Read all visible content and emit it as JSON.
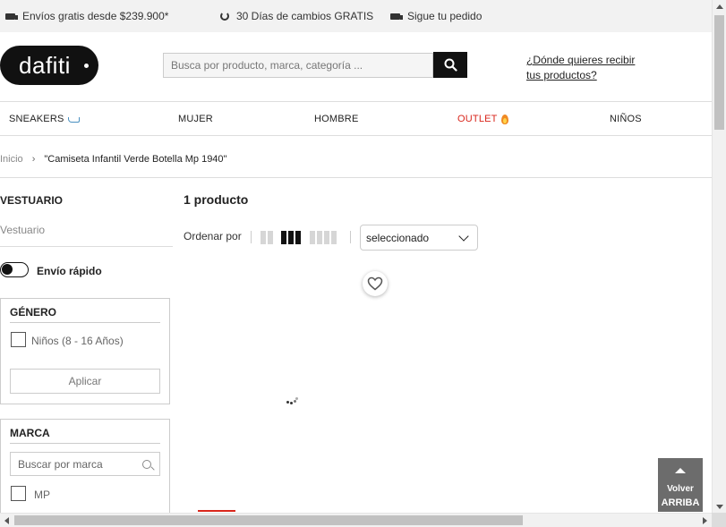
{
  "topbar": {
    "shipping": {
      "icon": "truck-icon",
      "text": "Envíos gratis desde $239.900*"
    },
    "returns": {
      "icon": "refresh-icon",
      "text": "30 Días de cambios GRATIS"
    },
    "tracking": {
      "icon": "truck-icon",
      "text": "Sigue tu pedido"
    }
  },
  "header": {
    "logo_text": "dafiti",
    "search_placeholder": "Busca por producto, marca, categoría ...",
    "search_value": "",
    "search_icon": "search-icon",
    "delivery_link": "¿Dónde quieres recibir tus productos?"
  },
  "nav": {
    "items": [
      {
        "label": "SNEAKERS",
        "icon": "sneaker-icon"
      },
      {
        "label": "MUJER"
      },
      {
        "label": "HOMBRE"
      },
      {
        "label": "OUTLET",
        "icon": "fire-icon",
        "color": "#d9261c"
      },
      {
        "label": "NIÑOS"
      }
    ]
  },
  "breadcrumb": {
    "home": "Inicio",
    "separator": "›",
    "current": "\"Camiseta Infantil Verde Botella Mp 1940\""
  },
  "sidebar": {
    "category_title": "VESTUARIO",
    "category_value": "Vestuario",
    "fast_shipping_label": "Envío rápido",
    "fast_shipping_on": false,
    "gender": {
      "title": "GÉNERO",
      "options": [
        {
          "label": "Niños (8 - 16 Años)",
          "checked": false
        }
      ],
      "apply_label": "Aplicar"
    },
    "brand": {
      "title": "MARCA",
      "search_placeholder": "Buscar por marca",
      "options": [
        {
          "label": "MP",
          "checked": false
        }
      ]
    }
  },
  "results": {
    "count_label": "1 producto",
    "sort_label": "Ordenar por",
    "grid_options": [
      "2-columns",
      "3-columns",
      "4-columns"
    ],
    "grid_selected": "3-columns",
    "sort_value": "seleccionado"
  },
  "product": {
    "wishlist_icon": "heart-icon",
    "loading": true
  },
  "back_to_top": {
    "line1": "Volver",
    "line2": "ARRIBA"
  },
  "colors": {
    "accent": "#111111",
    "outlet": "#d9261c",
    "topbar_bg": "#f2f2f2"
  }
}
